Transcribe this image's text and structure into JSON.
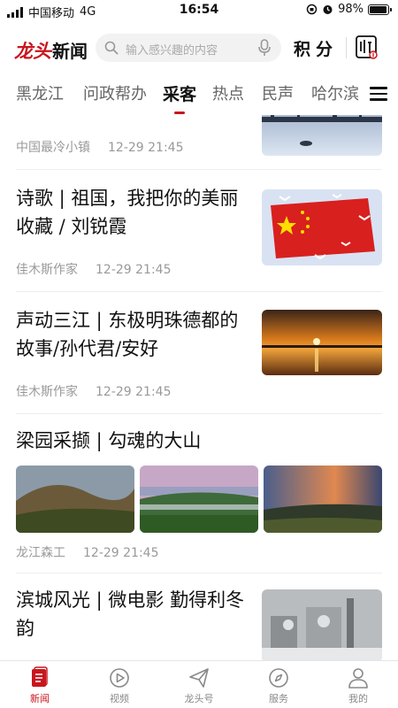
{
  "status_bar": {
    "carrier": "中国移动",
    "network": "4G",
    "time": "16:54",
    "battery": "98%",
    "battery_level": 0.98
  },
  "header": {
    "logo_part1": "龙头",
    "logo_part2": "新闻",
    "search_placeholder": "输入感兴趣的内容",
    "points_label": "积分",
    "icons": [
      "search-icon",
      "microphone-icon",
      "listen-icon"
    ]
  },
  "tabs": {
    "items": [
      "黑龙江",
      "问政帮办",
      "采客",
      "热点",
      "民声",
      "哈尔滨"
    ],
    "active": "采客"
  },
  "feed": {
    "items": [
      {
        "title": "",
        "source": "中国最冷小镇",
        "time": "12-29  21:45"
      },
      {
        "title": "诗歌  |  祖国，我把你的美丽收藏 / 刘锐霞",
        "source": "佳木斯作家",
        "time": "12-29  21:45"
      },
      {
        "title": "声动三江  |  东极明珠德都的故事/孙代君/安好",
        "source": "佳木斯作家",
        "time": "12-29  21:45"
      },
      {
        "title": "梁园采撷  |  勾魂的大山",
        "source": "龙江森工",
        "time": "12-29  21:45"
      },
      {
        "title": "滨城风光  |  微电影 勤得利冬韵",
        "source": "",
        "time": ""
      }
    ]
  },
  "bottom_nav": {
    "items": [
      "新闻",
      "视频",
      "龙头号",
      "服务",
      "我的"
    ],
    "active": "新闻"
  },
  "colors": {
    "brand_red": "#c8161d"
  }
}
